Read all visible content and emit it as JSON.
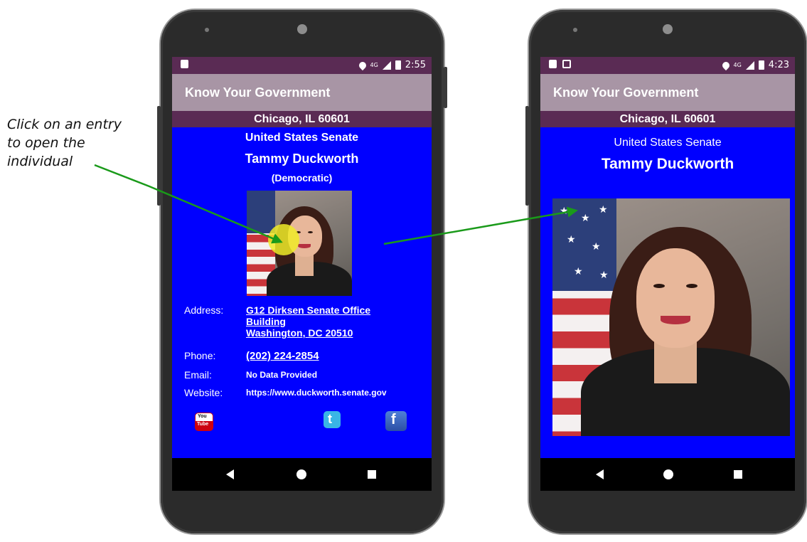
{
  "annotation": {
    "lines": [
      "Click on an entry",
      "to open the",
      "individual"
    ]
  },
  "status_left": {
    "time": "2:55",
    "network": "4G"
  },
  "status_right": {
    "time": "4:23",
    "network": "4G"
  },
  "app": {
    "title": "Know Your Government",
    "location": "Chicago, IL 60601"
  },
  "official": {
    "office": "United States Senate",
    "name": "Tammy Duckworth",
    "party": "(Democratic)",
    "address_label": "Address:",
    "address_line1": "G12 Dirksen Senate Office",
    "address_line2": "Building",
    "address_line3": "Washington, DC 20510",
    "phone_label": "Phone:",
    "phone": "(202) 224-2854",
    "email_label": "Email:",
    "email": "No Data Provided",
    "website_label": "Website:",
    "website": "https://www.duckworth.senate.gov"
  },
  "social": {
    "youtube_top": "You",
    "youtube_bottom": "Tube",
    "twitter_glyph": "t",
    "facebook_glyph": "f"
  },
  "icons": [
    "sd-card-icon",
    "location-icon",
    "signal-icon",
    "battery-icon",
    "back-icon",
    "home-icon",
    "recents-icon",
    "youtube-icon",
    "twitter-icon",
    "facebook-icon"
  ],
  "colors": {
    "screen_bg": "#0000ff",
    "status_bar": "#5a2b54",
    "app_bar": "#a895a5",
    "arrow": "#1a9a1a",
    "tap_indicator": "#f0eb28"
  }
}
